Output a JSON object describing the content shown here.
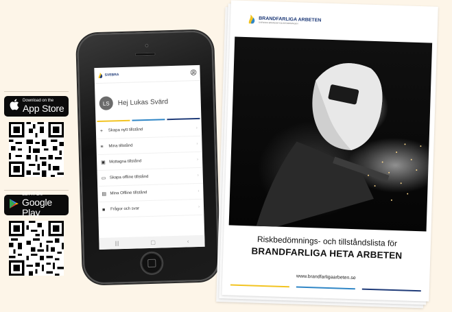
{
  "appstore": {
    "small": "Download on the",
    "big": "App Store"
  },
  "googleplay": {
    "small": "GET IT ON",
    "big": "Google Play"
  },
  "app": {
    "brand": "SVEBRA",
    "greeting": "Hej Lukas Svärd",
    "avatar_initials": "LS",
    "menu": [
      {
        "icon": "plus-icon",
        "glyph": "+",
        "label": "Skapa nytt tillstånd"
      },
      {
        "icon": "list-icon",
        "glyph": "≡",
        "label": "Mina tillstånd"
      },
      {
        "icon": "inbox-icon",
        "glyph": "▣",
        "label": "Mottagna tillstånd"
      },
      {
        "icon": "monitor-icon",
        "glyph": "▭",
        "label": "Skapa offline tillstånd"
      },
      {
        "icon": "grid-icon",
        "glyph": "▤",
        "label": "Mina Offline tillstånd"
      },
      {
        "icon": "chat-icon",
        "glyph": "■",
        "label": "Frågor och svar"
      }
    ],
    "nav": [
      "|||",
      "▢",
      "‹"
    ]
  },
  "booklet": {
    "brand": "BRANDFARLIGA ARBETEN",
    "tagline": "SVENSKA BRANDSKYDDSFÖRENINGEN",
    "subtitle": "Riskbedömnings- och tillståndslista för",
    "title": "BRANDFARLIGA HETA ARBETEN",
    "url": "www.brandfarligaarbeten.se"
  },
  "colors": {
    "yellow": "#f2c320",
    "blue": "#2f86c6",
    "navy": "#1e3a78"
  }
}
